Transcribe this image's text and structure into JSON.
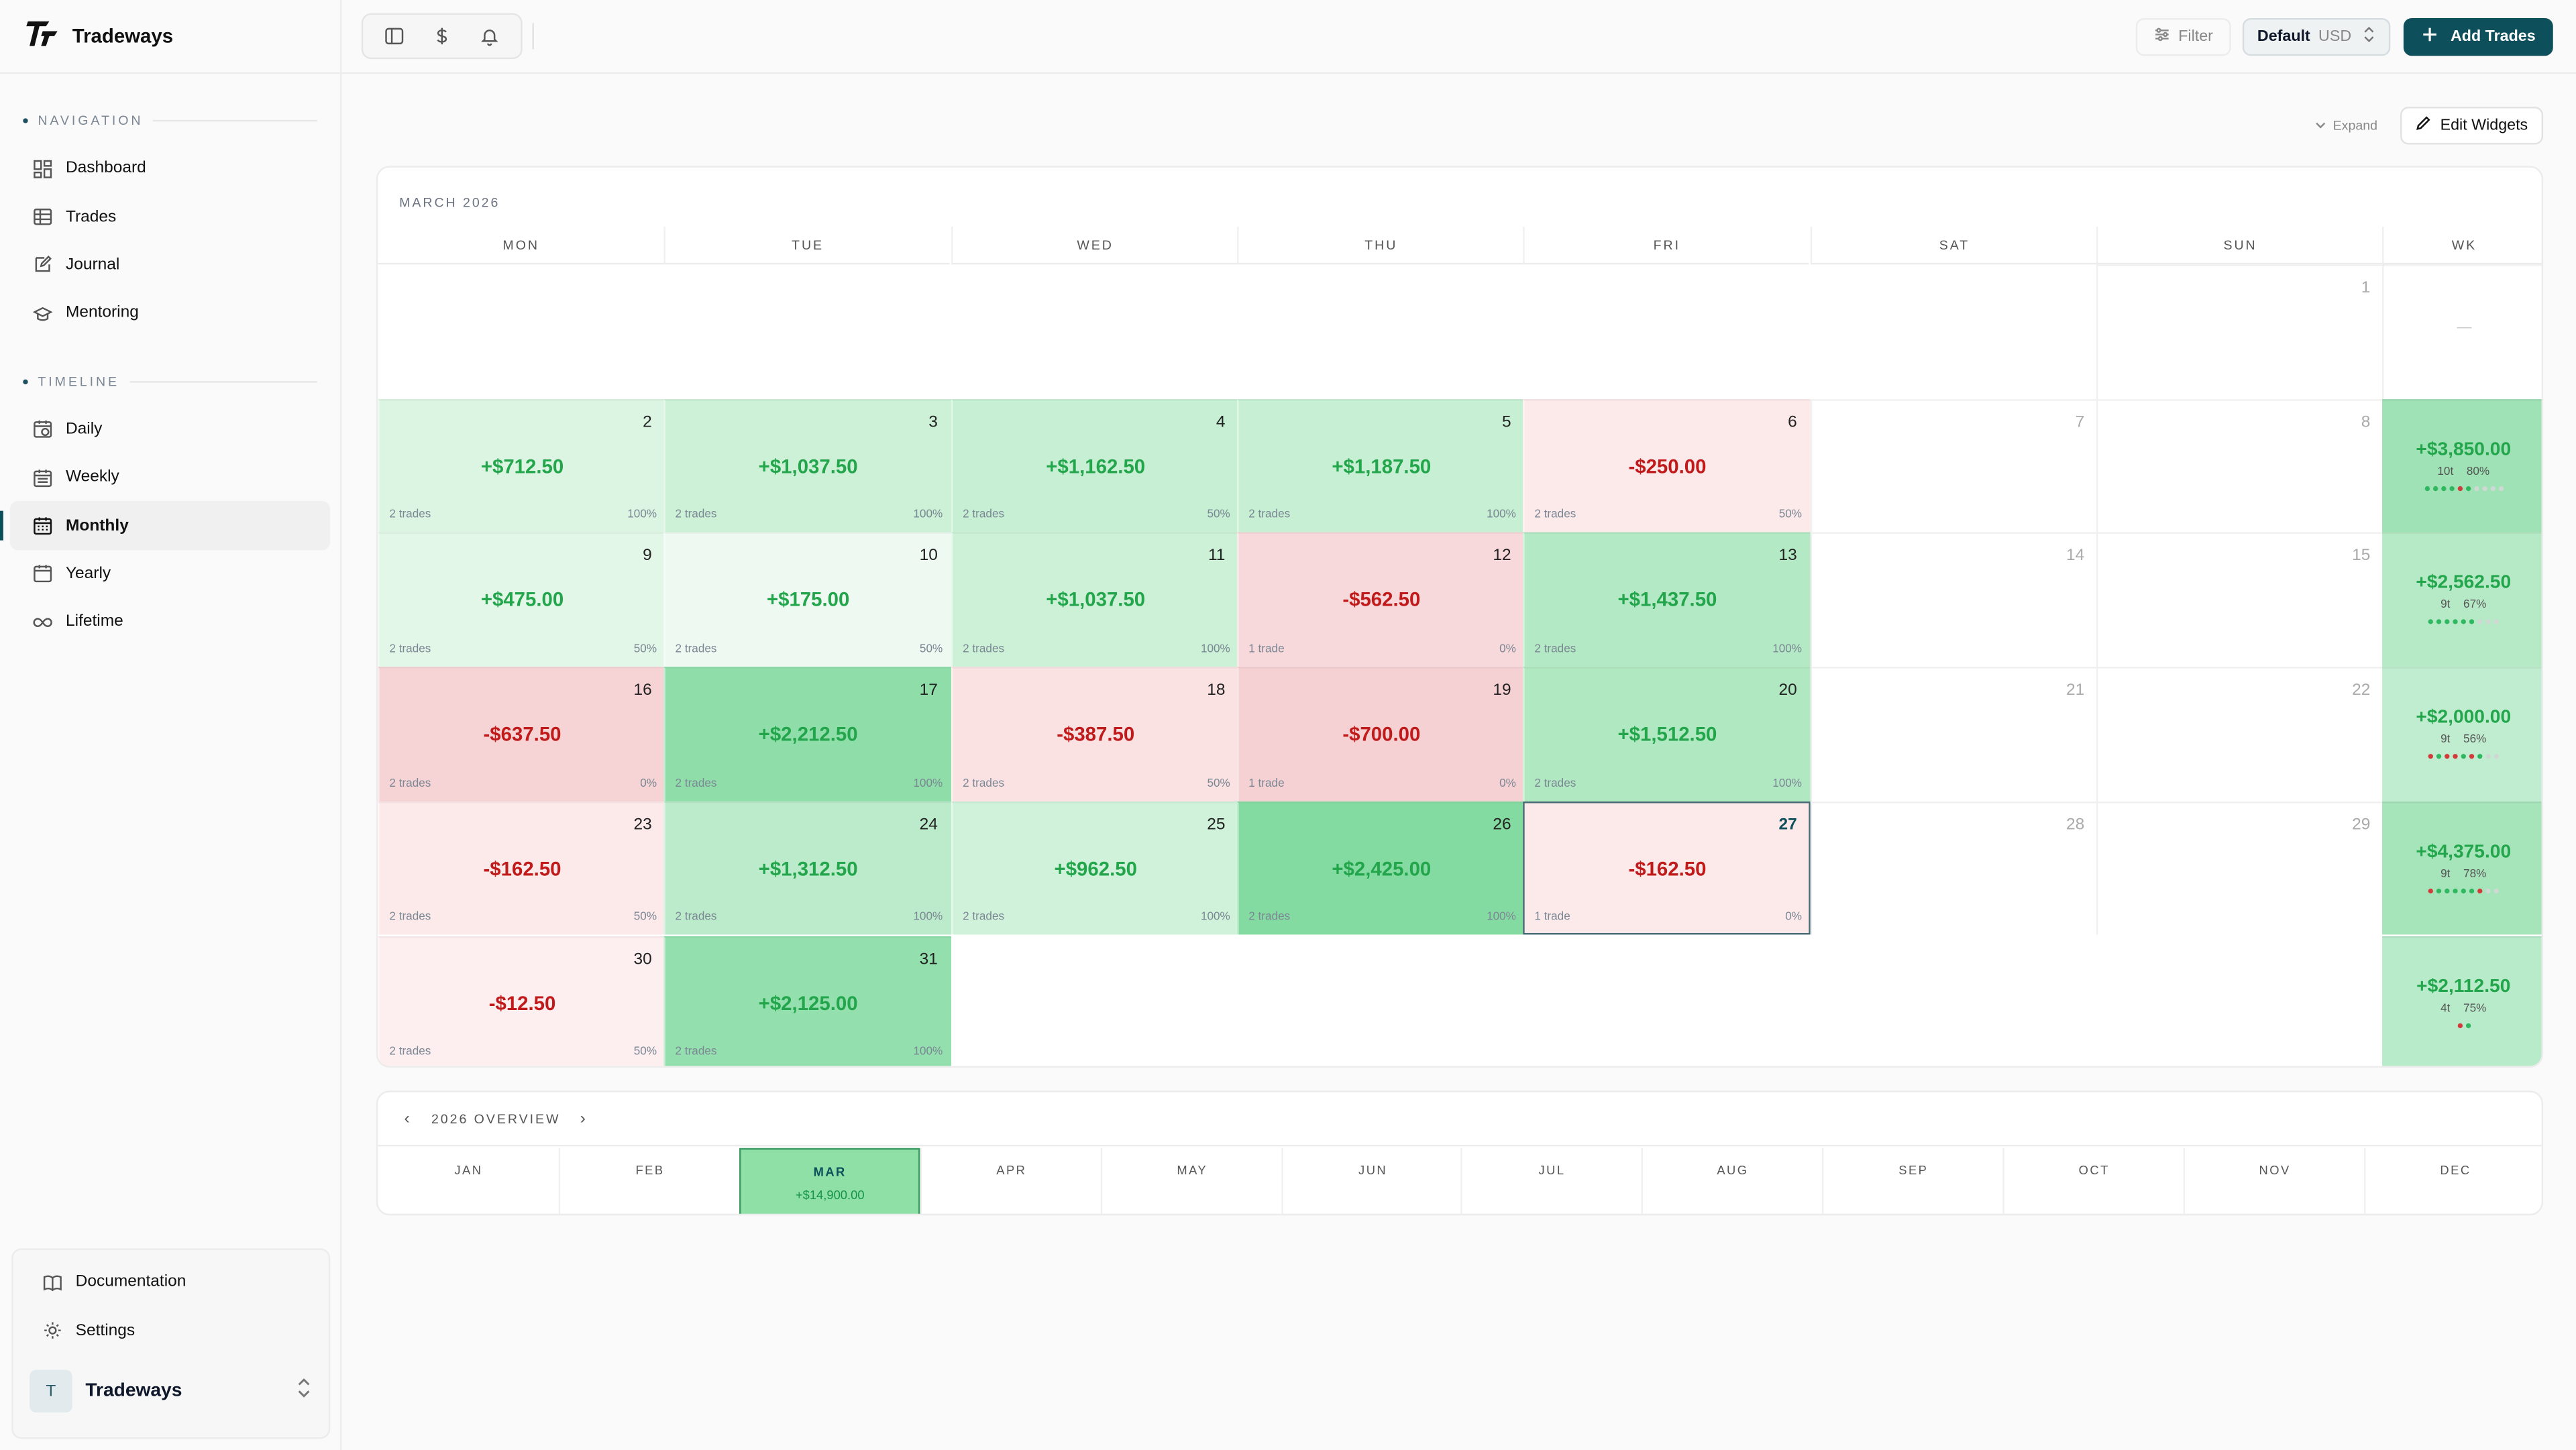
{
  "app": {
    "name": "Tradeways"
  },
  "sidebar": {
    "navigation_title": "NAVIGATION",
    "navigation": [
      {
        "label": "Dashboard",
        "icon": "dashboard-icon"
      },
      {
        "label": "Trades",
        "icon": "table-icon"
      },
      {
        "label": "Journal",
        "icon": "journal-icon"
      },
      {
        "label": "Mentoring",
        "icon": "graduation-cap-icon"
      }
    ],
    "timeline_title": "TIMELINE",
    "timeline": [
      {
        "label": "Daily",
        "icon": "calendar-clock-icon"
      },
      {
        "label": "Weekly",
        "icon": "calendar-week-icon"
      },
      {
        "label": "Monthly",
        "icon": "calendar-month-icon",
        "active": true
      },
      {
        "label": "Yearly",
        "icon": "calendar-icon"
      },
      {
        "label": "Lifetime",
        "icon": "infinity-icon"
      }
    ],
    "footer": [
      {
        "label": "Documentation",
        "icon": "book-icon"
      },
      {
        "label": "Settings",
        "icon": "gear-icon"
      }
    ],
    "user": {
      "initial": "T",
      "name": "Tradeways"
    }
  },
  "topbar": {
    "filter_label": "Filter",
    "account_label": "Default",
    "currency": "USD",
    "add_trades_label": "Add Trades"
  },
  "toolbar": {
    "expand_label": "Expand",
    "edit_widgets_label": "Edit Widgets"
  },
  "calendar": {
    "title": "MARCH 2026",
    "day_headers": [
      "MON",
      "TUE",
      "WED",
      "THU",
      "FRI",
      "SAT",
      "SUN",
      "WK"
    ],
    "cells": [
      {
        "d": "1",
        "r": 0,
        "c": 6
      },
      {
        "d": "2",
        "r": 1,
        "c": 0,
        "amt": "+$712.50",
        "trades": "2 trades",
        "win": "100%",
        "s": "pos",
        "bg": "#dcf5e2"
      },
      {
        "d": "3",
        "r": 1,
        "c": 1,
        "amt": "+$1,037.50",
        "trades": "2 trades",
        "win": "100%",
        "s": "pos",
        "bg": "#ccf1d7"
      },
      {
        "d": "4",
        "r": 1,
        "c": 2,
        "amt": "+$1,162.50",
        "trades": "2 trades",
        "win": "50%",
        "s": "pos",
        "bg": "#c6efd3"
      },
      {
        "d": "5",
        "r": 1,
        "c": 3,
        "amt": "+$1,187.50",
        "trades": "2 trades",
        "win": "100%",
        "s": "pos",
        "bg": "#c6efd3"
      },
      {
        "d": "6",
        "r": 1,
        "c": 4,
        "amt": "-$250.00",
        "trades": "2 trades",
        "win": "50%",
        "s": "neg",
        "bg": "#fce9ea"
      },
      {
        "d": "7",
        "r": 1,
        "c": 5
      },
      {
        "d": "8",
        "r": 1,
        "c": 6
      },
      {
        "d": "9",
        "r": 2,
        "c": 0,
        "amt": "+$475.00",
        "trades": "2 trades",
        "win": "50%",
        "s": "pos",
        "bg": "#e3f7e8"
      },
      {
        "d": "10",
        "r": 2,
        "c": 1,
        "amt": "+$175.00",
        "trades": "2 trades",
        "win": "50%",
        "s": "pos",
        "bg": "#eefaf1"
      },
      {
        "d": "11",
        "r": 2,
        "c": 2,
        "amt": "+$1,037.50",
        "trades": "2 trades",
        "win": "100%",
        "s": "pos",
        "bg": "#ccf1d7"
      },
      {
        "d": "12",
        "r": 2,
        "c": 3,
        "amt": "-$562.50",
        "trades": "1 trade",
        "win": "0%",
        "s": "neg",
        "bg": "#f8d9db"
      },
      {
        "d": "13",
        "r": 2,
        "c": 4,
        "amt": "+$1,437.50",
        "trades": "2 trades",
        "win": "100%",
        "s": "pos",
        "bg": "#b3e9c4"
      },
      {
        "d": "14",
        "r": 2,
        "c": 5
      },
      {
        "d": "15",
        "r": 2,
        "c": 6
      },
      {
        "d": "16",
        "r": 3,
        "c": 0,
        "amt": "-$637.50",
        "trades": "2 trades",
        "win": "0%",
        "s": "neg",
        "bg": "#f6d4d6"
      },
      {
        "d": "17",
        "r": 3,
        "c": 1,
        "amt": "+$2,212.50",
        "trades": "2 trades",
        "win": "100%",
        "s": "pos",
        "bg": "#8fdeaa"
      },
      {
        "d": "18",
        "r": 3,
        "c": 2,
        "amt": "-$387.50",
        "trades": "2 trades",
        "win": "50%",
        "s": "neg",
        "bg": "#fae2e3"
      },
      {
        "d": "19",
        "r": 3,
        "c": 3,
        "amt": "-$700.00",
        "trades": "1 trade",
        "win": "0%",
        "s": "neg",
        "bg": "#f5d1d3"
      },
      {
        "d": "20",
        "r": 3,
        "c": 4,
        "amt": "+$1,512.50",
        "trades": "2 trades",
        "win": "100%",
        "s": "pos",
        "bg": "#b0e8c1"
      },
      {
        "d": "21",
        "r": 3,
        "c": 5
      },
      {
        "d": "22",
        "r": 3,
        "c": 6
      },
      {
        "d": "23",
        "r": 4,
        "c": 0,
        "amt": "-$162.50",
        "trades": "2 trades",
        "win": "50%",
        "s": "neg",
        "bg": "#fceaeb"
      },
      {
        "d": "24",
        "r": 4,
        "c": 1,
        "amt": "+$1,312.50",
        "trades": "2 trades",
        "win": "100%",
        "s": "pos",
        "bg": "#bcebcb"
      },
      {
        "d": "25",
        "r": 4,
        "c": 2,
        "amt": "+$962.50",
        "trades": "2 trades",
        "win": "100%",
        "s": "pos",
        "bg": "#d0f2da"
      },
      {
        "d": "26",
        "r": 4,
        "c": 3,
        "amt": "+$2,425.00",
        "trades": "2 trades",
        "win": "100%",
        "s": "pos",
        "bg": "#84dba1"
      },
      {
        "d": "27",
        "r": 4,
        "c": 4,
        "amt": "-$162.50",
        "trades": "1 trade",
        "win": "0%",
        "s": "neg",
        "bg": "#fceaeb",
        "today": true
      },
      {
        "d": "28",
        "r": 4,
        "c": 5
      },
      {
        "d": "29",
        "r": 4,
        "c": 6
      },
      {
        "d": "30",
        "r": 5,
        "c": 0,
        "amt": "-$12.50",
        "trades": "2 trades",
        "win": "50%",
        "s": "neg",
        "bg": "#fdeeef"
      },
      {
        "d": "31",
        "r": 5,
        "c": 1,
        "amt": "+$2,125.00",
        "trades": "2 trades",
        "win": "100%",
        "s": "pos",
        "bg": "#93dfad"
      }
    ],
    "weeks": [
      {
        "r": 0,
        "placeholder": "—"
      },
      {
        "r": 1,
        "amt": "+$3,850.00",
        "trades": "10t",
        "win": "80%",
        "bg": "#9fe2b5",
        "dots": [
          "g",
          "g",
          "g",
          "g",
          "r",
          "g",
          "l",
          "l",
          "l",
          "l"
        ]
      },
      {
        "r": 2,
        "amt": "+$2,562.50",
        "trades": "9t",
        "win": "67%",
        "bg": "#b6eac7",
        "dots": [
          "g",
          "g",
          "g",
          "g",
          "g",
          "g",
          "l",
          "l",
          "l"
        ]
      },
      {
        "r": 3,
        "amt": "+$2,000.00",
        "trades": "9t",
        "win": "56%",
        "bg": "#c0edcf",
        "dots": [
          "r",
          "g",
          "r",
          "r",
          "g",
          "r",
          "g",
          "l",
          "l"
        ]
      },
      {
        "r": 4,
        "amt": "+$4,375.00",
        "trades": "9t",
        "win": "78%",
        "bg": "#a6e4ba",
        "dots": [
          "r",
          "g",
          "g",
          "g",
          "g",
          "g",
          "r",
          "l",
          "l"
        ]
      },
      {
        "r": 5,
        "amt": "+$2,112.50",
        "trades": "4t",
        "win": "75%",
        "bg": "#b8ebc9",
        "dots": [
          "r",
          "g"
        ]
      }
    ]
  },
  "overview": {
    "title": "2026 OVERVIEW",
    "months": [
      {
        "label": "JAN"
      },
      {
        "label": "FEB"
      },
      {
        "label": "MAR",
        "value": "+$14,900.00",
        "active": true
      },
      {
        "label": "APR"
      },
      {
        "label": "MAY"
      },
      {
        "label": "JUN"
      },
      {
        "label": "JUL"
      },
      {
        "label": "AUG"
      },
      {
        "label": "SEP"
      },
      {
        "label": "OCT"
      },
      {
        "label": "NOV"
      },
      {
        "label": "DEC"
      }
    ]
  },
  "colors": {
    "accent": "#0e4f5c",
    "positive": "#22a54b",
    "negative": "#c01a1a",
    "dot_green": "#2fb860",
    "dot_red": "#d13b3b",
    "dot_light": "#cfd8d2"
  }
}
